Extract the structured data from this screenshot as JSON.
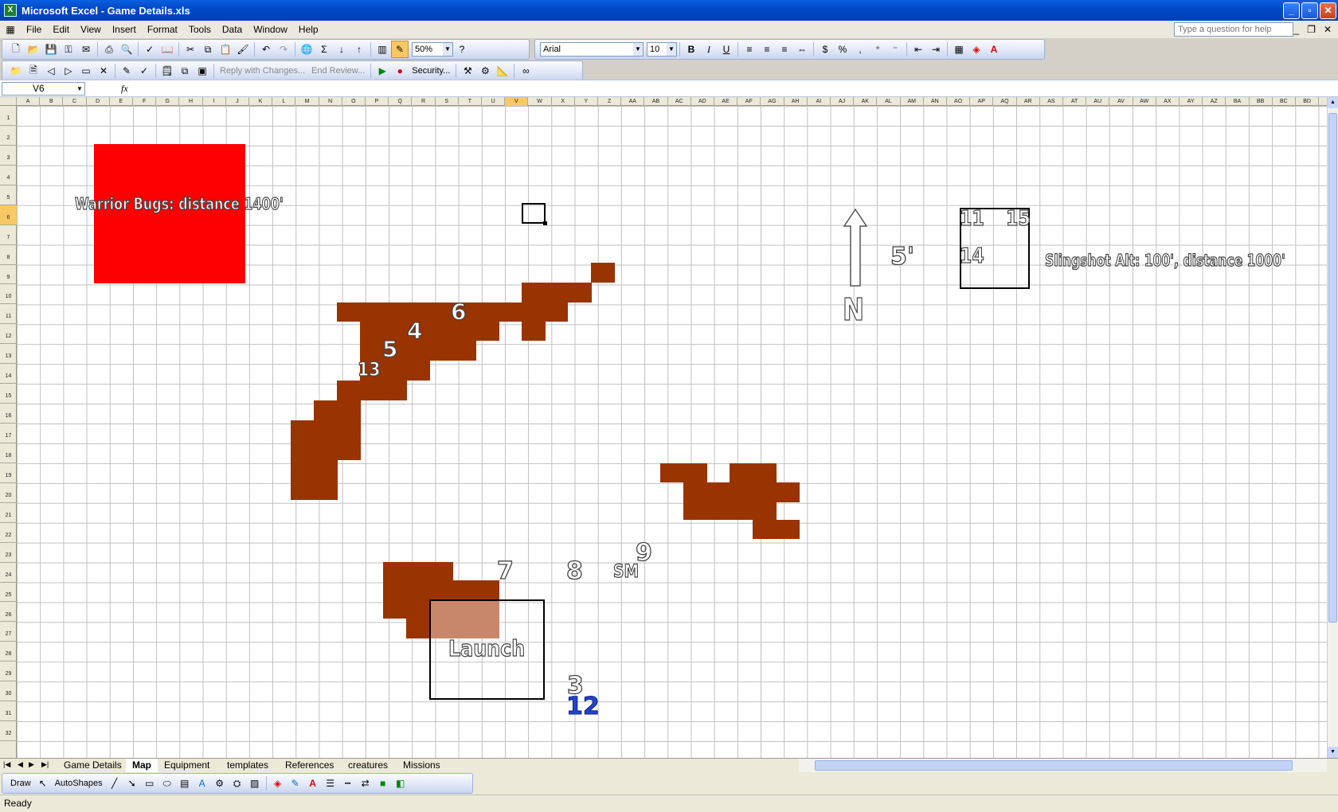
{
  "window": {
    "title": "Microsoft Excel - Game Details.xls"
  },
  "menu": [
    "File",
    "Edit",
    "View",
    "Insert",
    "Format",
    "Tools",
    "Data",
    "Window",
    "Help"
  ],
  "help_placeholder": "Type a question for help",
  "toolbar": {
    "zoom": "50%",
    "font": "Arial",
    "font_size": "10",
    "reply_label": "Reply with Changes...",
    "end_review_label": "End Review...",
    "security_label": "Security..."
  },
  "formula": {
    "name_box": "V6",
    "fx": "fx",
    "content": ""
  },
  "columns": [
    "A",
    "B",
    "C",
    "D",
    "E",
    "F",
    "G",
    "H",
    "I",
    "J",
    "K",
    "L",
    "M",
    "N",
    "O",
    "P",
    "Q",
    "R",
    "S",
    "T",
    "U",
    "V",
    "W",
    "X",
    "Y",
    "Z",
    "AA",
    "AB",
    "AC",
    "AD",
    "AE",
    "AF",
    "AG",
    "AH",
    "AI",
    "AJ",
    "AK",
    "AL",
    "AM",
    "AN",
    "AO",
    "AP",
    "AQ",
    "AR",
    "AS",
    "AT",
    "AU",
    "AV",
    "AW",
    "AX",
    "AY",
    "AZ",
    "BA",
    "BB",
    "BC",
    "BD"
  ],
  "rows": [
    "1",
    "2",
    "3",
    "4",
    "5",
    "6",
    "7",
    "8",
    "9",
    "10",
    "11",
    "12",
    "13",
    "14",
    "15",
    "16",
    "17",
    "18",
    "19",
    "20",
    "21",
    "22",
    "23",
    "24",
    "25",
    "26",
    "27",
    "28",
    "29",
    "30",
    "31",
    "32"
  ],
  "selected": {
    "column": "V",
    "row": "6"
  },
  "map": {
    "warrior_bugs": "Warrior Bugs: distance 1400'",
    "slingshot": "Slingshot Alt: 100', distance 1000'",
    "launch": "Launch",
    "north": "N",
    "scale": "5'",
    "markers": {
      "m11": "11",
      "m15": "15",
      "m14": "14",
      "m6": "6",
      "m4": "4",
      "m5": "5",
      "m13": "13",
      "m7": "7",
      "m8": "8",
      "m9": "9",
      "sm": "SM",
      "m3": "3",
      "m12": "12"
    },
    "colors": {
      "warrior_box": "#ff0000",
      "terrain": "#993300",
      "launch_overlay": "#c8866a",
      "marker_12": "#2244cc"
    }
  },
  "tabs": [
    "Game Details",
    "Map",
    "Equipment",
    "templates",
    "References",
    "creatures",
    "Missions"
  ],
  "active_tab": "Map",
  "drawbar": {
    "draw": "Draw",
    "autoshapes": "AutoShapes"
  },
  "status": "Ready"
}
